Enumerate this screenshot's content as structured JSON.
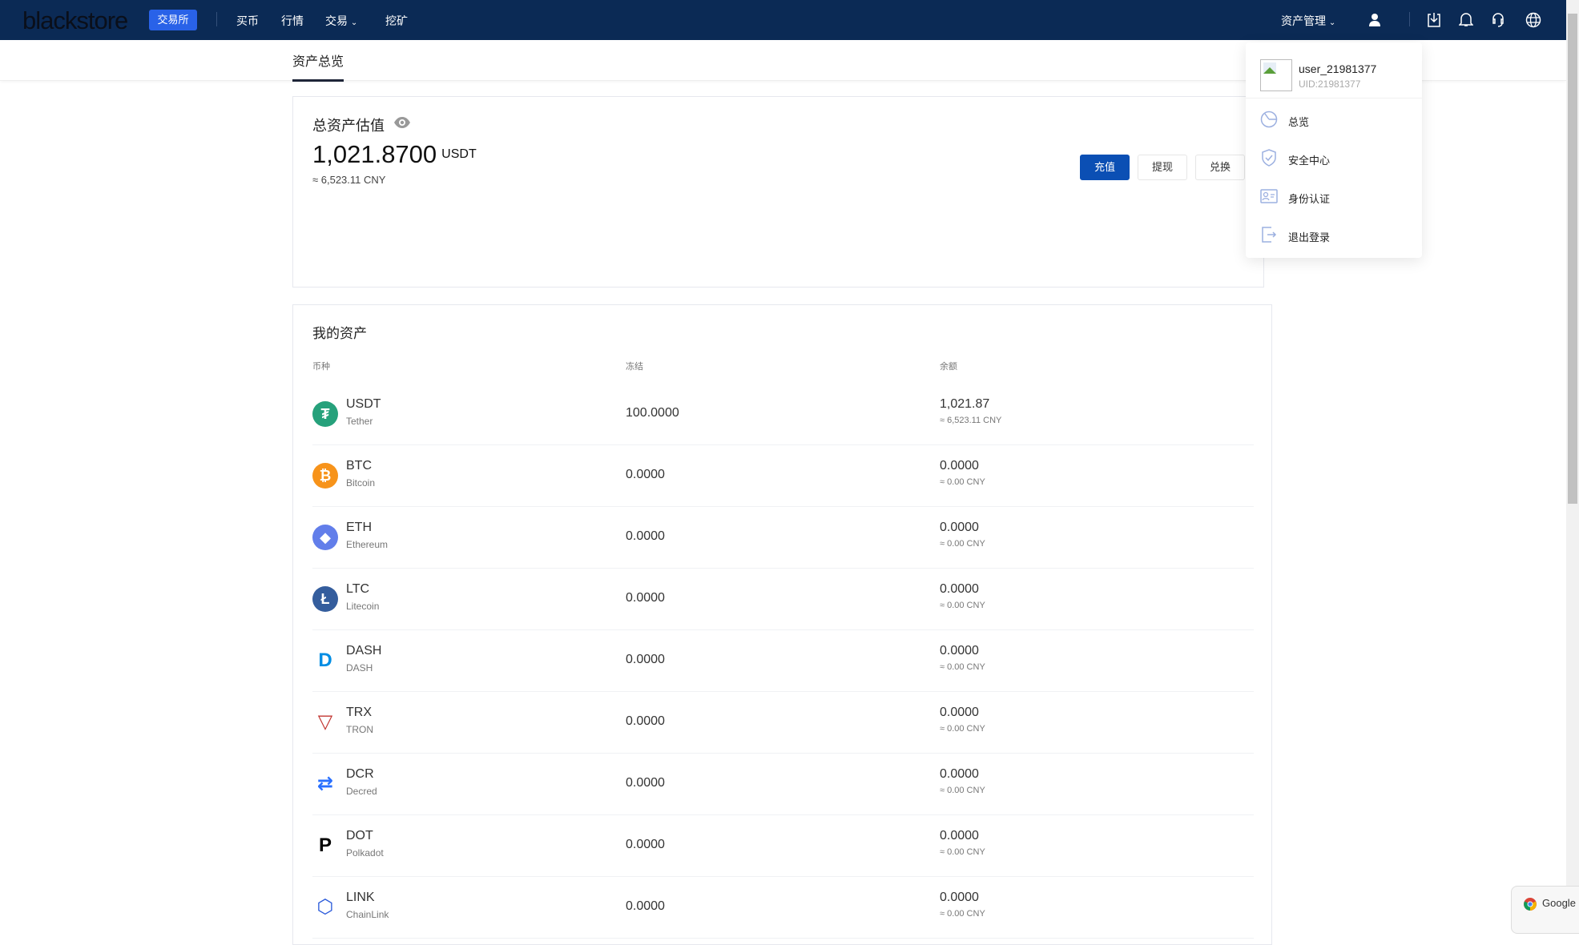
{
  "nav": {
    "logo": "blackstore",
    "exchange_badge": "交易所",
    "items": [
      "买币",
      "行情",
      "交易",
      "挖矿"
    ],
    "asset_mgmt": "资产管理"
  },
  "subnav": {
    "tab": "资产总览"
  },
  "summary": {
    "title": "总资产估值",
    "amount": "1,021.8700",
    "unit": "USDT",
    "cny": "≈ 6,523.11 CNY",
    "buttons": {
      "deposit": "充值",
      "withdraw": "提现",
      "exchange": "兑换"
    },
    "accent": "#0b4fb4"
  },
  "assets": {
    "title": "我的资产",
    "columns": [
      "币种",
      "冻结",
      "余额"
    ],
    "rows": [
      {
        "symbol": "USDT",
        "name": "Tether",
        "frozen": "100.0000",
        "balance": "1,021.87",
        "cny": "≈ 6,523.11 CNY",
        "icon": "tether-icon",
        "color": "#26a17b"
      },
      {
        "symbol": "BTC",
        "name": "Bitcoin",
        "frozen": "0.0000",
        "balance": "0.0000",
        "cny": "≈ 0.00 CNY",
        "icon": "bitcoin-icon",
        "color": "#f7931a"
      },
      {
        "symbol": "ETH",
        "name": "Ethereum",
        "frozen": "0.0000",
        "balance": "0.0000",
        "cny": "≈ 0.00 CNY",
        "icon": "ethereum-icon",
        "color": "#627eea"
      },
      {
        "symbol": "LTC",
        "name": "Litecoin",
        "frozen": "0.0000",
        "balance": "0.0000",
        "cny": "≈ 0.00 CNY",
        "icon": "litecoin-icon",
        "color": "#345d9d"
      },
      {
        "symbol": "DASH",
        "name": "DASH",
        "frozen": "0.0000",
        "balance": "0.0000",
        "cny": "≈ 0.00 CNY",
        "icon": "dash-icon",
        "color": "#008de4"
      },
      {
        "symbol": "TRX",
        "name": "TRON",
        "frozen": "0.0000",
        "balance": "0.0000",
        "cny": "≈ 0.00 CNY",
        "icon": "tron-icon",
        "color": "#c23631"
      },
      {
        "symbol": "DCR",
        "name": "Decred",
        "frozen": "0.0000",
        "balance": "0.0000",
        "cny": "≈ 0.00 CNY",
        "icon": "decred-icon",
        "color": "#2970ff"
      },
      {
        "symbol": "DOT",
        "name": "Polkadot",
        "frozen": "0.0000",
        "balance": "0.0000",
        "cny": "≈ 0.00 CNY",
        "icon": "polkadot-icon",
        "color": "#000000"
      },
      {
        "symbol": "LINK",
        "name": "ChainLink",
        "frozen": "0.0000",
        "balance": "0.0000",
        "cny": "≈ 0.00 CNY",
        "icon": "chainlink-icon",
        "color": "#2a5ada"
      }
    ]
  },
  "user_menu": {
    "username": "user_21981377",
    "uid": "UID:21981377",
    "items": [
      {
        "label": "总览",
        "icon": "pie-chart-icon"
      },
      {
        "label": "安全中心",
        "icon": "shield-check-icon"
      },
      {
        "label": "身份认证",
        "icon": "id-card-icon"
      },
      {
        "label": "退出登录",
        "icon": "logout-icon"
      }
    ]
  },
  "popup": {
    "label": "Google C"
  }
}
